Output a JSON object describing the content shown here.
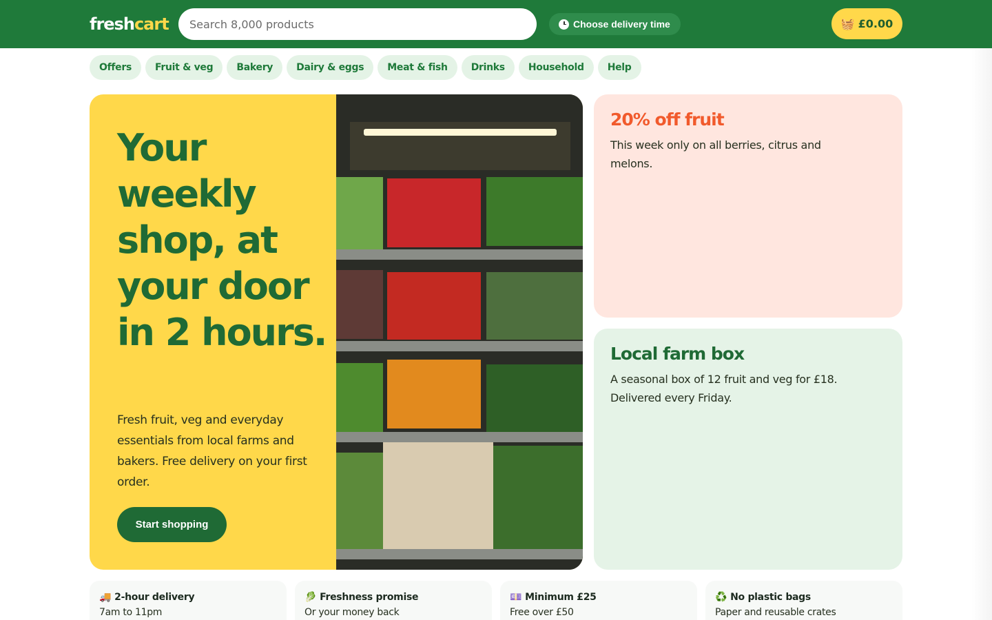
{
  "header": {
    "logo_part1": "fresh",
    "logo_part2": "cart",
    "search_placeholder": "Search 8,000 products",
    "delivery_label": "Choose delivery time",
    "cart_total": "£0.00"
  },
  "nav": {
    "items": [
      {
        "label": "Offers"
      },
      {
        "label": "Fruit & veg"
      },
      {
        "label": "Bakery"
      },
      {
        "label": "Dairy & eggs"
      },
      {
        "label": "Meat & fish"
      },
      {
        "label": "Drinks"
      },
      {
        "label": "Household"
      },
      {
        "label": "Help"
      }
    ]
  },
  "hero": {
    "title": "Your weekly shop, at your door in 2 hours.",
    "text": "Fresh fruit, veg and everyday essentials from local farms and bakers. Free delivery on your first order.",
    "cta": "Start shopping"
  },
  "promos": [
    {
      "title": "20% off fruit",
      "text": "This week only on all berries, citrus and melons."
    },
    {
      "title": "Local farm box",
      "text": "A seasonal box of 12 fruit and veg for £18. Delivered every Friday."
    }
  ],
  "features": [
    {
      "icon": "truck-icon",
      "title": "2-hour delivery",
      "sub": "7am to 11pm"
    },
    {
      "icon": "leaf-icon",
      "title": "Freshness promise",
      "sub": "Or your money back"
    },
    {
      "icon": "money-icon",
      "title": "Minimum £25",
      "sub": "Free over £50"
    },
    {
      "icon": "recycle-icon",
      "title": "No plastic bags",
      "sub": "Paper and reusable crates"
    }
  ],
  "colors": {
    "brand_green": "#1f7a3a",
    "brand_yellow": "#ffd84a",
    "promo_orange": "#f15a2c"
  }
}
